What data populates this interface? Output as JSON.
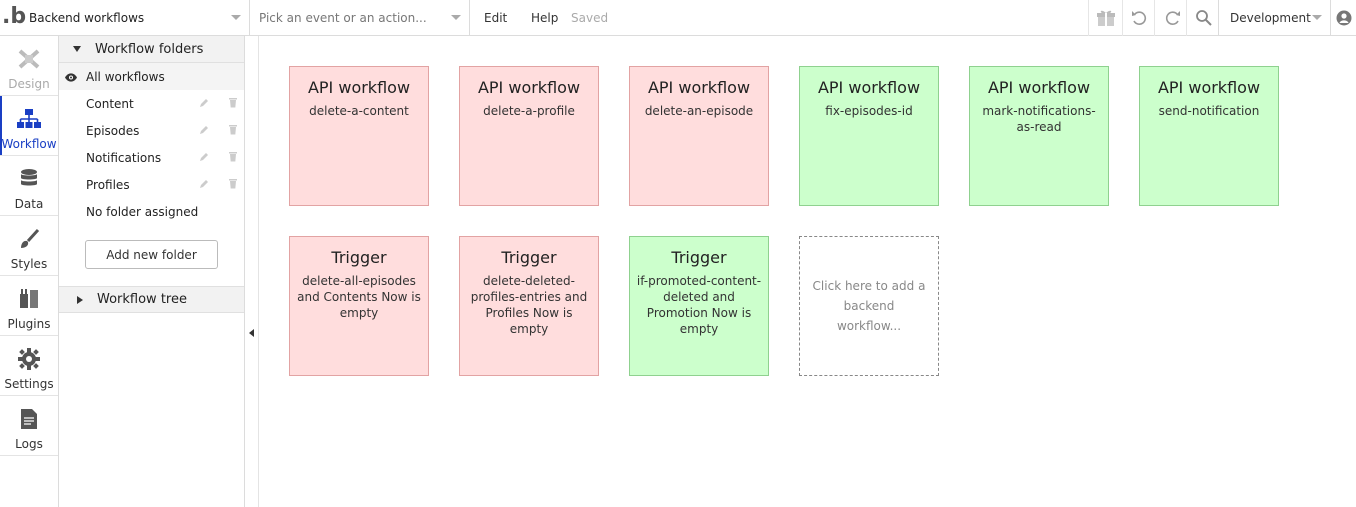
{
  "topbar": {
    "logo": ".b",
    "page_select": "Backend workflows",
    "event_placeholder": "Pick an event or an action...",
    "edit_label": "Edit",
    "help_label": "Help",
    "status": "Saved",
    "environment": "Development",
    "icons": [
      "gift-icon",
      "undo-icon",
      "redo-icon",
      "search-icon",
      "user-icon"
    ]
  },
  "leftnav": {
    "items": [
      {
        "label": "Design",
        "icon": "design-icon",
        "state": "disabled"
      },
      {
        "label": "Workflow",
        "icon": "workflow-icon",
        "state": "active"
      },
      {
        "label": "Data",
        "icon": "database-icon",
        "state": "normal"
      },
      {
        "label": "Styles",
        "icon": "brush-icon",
        "state": "normal"
      },
      {
        "label": "Plugins",
        "icon": "plug-icon",
        "state": "normal"
      },
      {
        "label": "Settings",
        "icon": "gear-icon",
        "state": "normal"
      },
      {
        "label": "Logs",
        "icon": "document-icon",
        "state": "normal"
      }
    ]
  },
  "folders": {
    "header": "Workflow folders",
    "all_label": "All workflows",
    "items": [
      {
        "label": "Content"
      },
      {
        "label": "Episodes"
      },
      {
        "label": "Notifications"
      },
      {
        "label": "Profiles"
      }
    ],
    "unassigned_label": "No folder assigned",
    "add_button": "Add new folder",
    "tree_header": "Workflow tree"
  },
  "workflows": [
    {
      "type": "API workflow",
      "name": "delete-a-content",
      "color": "red"
    },
    {
      "type": "API workflow",
      "name": "delete-a-profile",
      "color": "red"
    },
    {
      "type": "API workflow",
      "name": "delete-an-episode",
      "color": "red"
    },
    {
      "type": "API workflow",
      "name": "fix-episodes-id",
      "color": "green"
    },
    {
      "type": "API workflow",
      "name": "mark-notifications-as-read",
      "color": "green"
    },
    {
      "type": "API workflow",
      "name": "send-notification",
      "color": "green"
    },
    {
      "type": "Trigger",
      "name": "delete-all-episodes and Contents Now is empty",
      "color": "red"
    },
    {
      "type": "Trigger",
      "name": "delete-deleted-profiles-entries and Profiles Now is empty",
      "color": "red"
    },
    {
      "type": "Trigger",
      "name": "if-promoted-content-deleted and Promotion Now is empty",
      "color": "green"
    }
  ],
  "add_workflow_text": "Click here to add a backend workflow...",
  "colors": {
    "red_bg": "#ffdddd",
    "green_bg": "#ccffcc",
    "accent": "#1a3fc4"
  }
}
